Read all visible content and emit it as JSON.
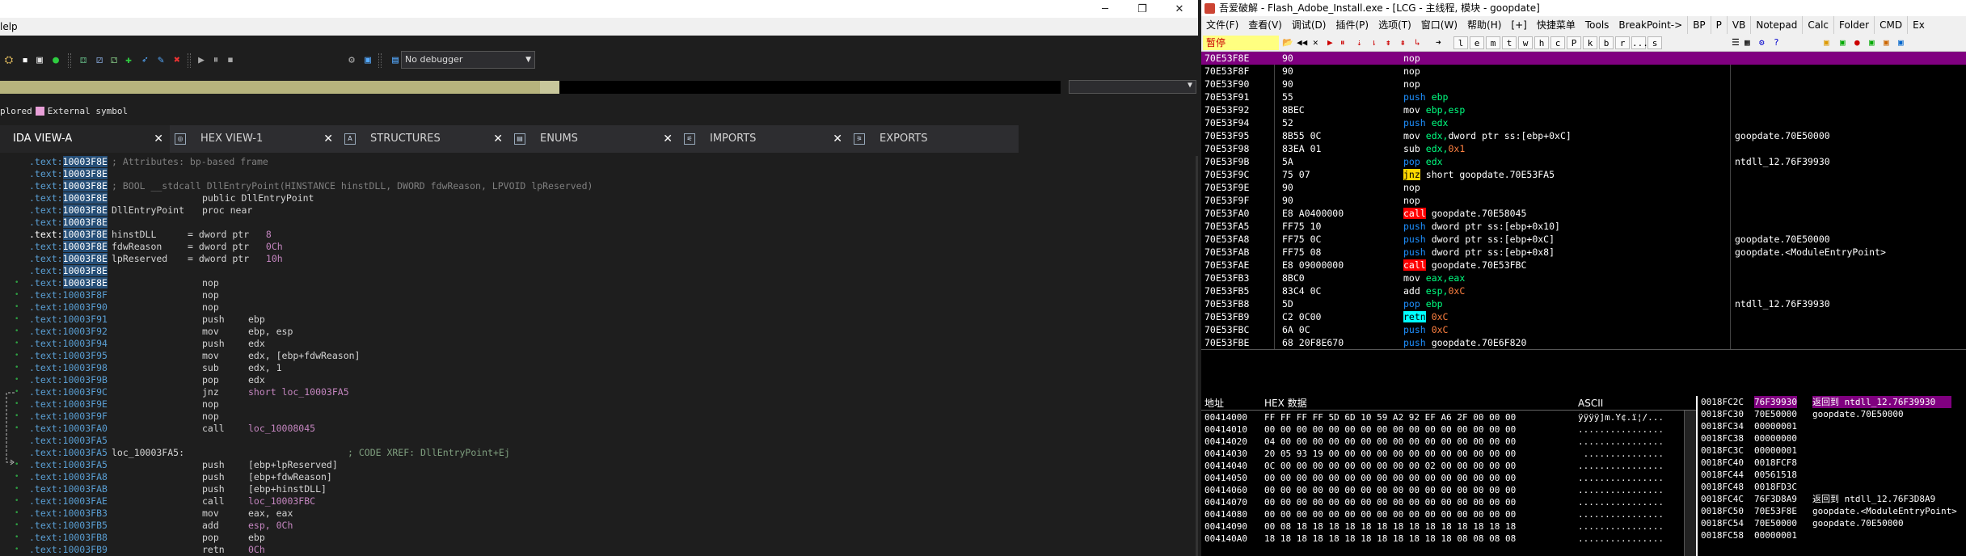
{
  "ida": {
    "menu_help": "lelp",
    "window_buttons": [
      "─",
      "❐",
      "✕"
    ],
    "debugger_select": "No debugger",
    "legend": [
      {
        "label": "plored",
        "color": ""
      },
      {
        "label": "External symbol",
        "color": "#e8a0d8"
      }
    ],
    "tabs": [
      {
        "label": "IDA VIEW-A",
        "icon": "",
        "close": "✕",
        "active": true
      },
      {
        "label": "HEX VIEW-1",
        "icon": "◎",
        "close": "✕",
        "active": false
      },
      {
        "label": "STRUCTURES",
        "icon": "A",
        "close": "✕",
        "active": false
      },
      {
        "label": "ENUMS",
        "icon": "▤",
        "close": "✕",
        "active": false
      },
      {
        "label": "IMPORTS",
        "icon": "⚟",
        "close": "✕",
        "active": false
      },
      {
        "label": "EXPORTS",
        "icon": "⚞",
        "close": "",
        "active": false
      }
    ],
    "code_lines": [
      {
        "dot": "",
        "addr": ".text:",
        "addr_hl": "10003F8E",
        "kind": "cmt",
        "text": "; Attributes: bp-based frame"
      },
      {
        "dot": "",
        "addr": ".text:",
        "addr_hl": "10003F8E",
        "kind": "blank",
        "text": ""
      },
      {
        "dot": "",
        "addr": ".text:",
        "addr_hl": "10003F8E",
        "kind": "cmt",
        "text": "; BOOL __stdcall DllEntryPoint(HINSTANCE hinstDLL, DWORD fdwReason, LPVOID lpReserved)"
      },
      {
        "dot": "",
        "addr": ".text:",
        "addr_hl": "10003F8E",
        "kind": "decl",
        "text": "public DllEntryPoint"
      },
      {
        "dot": "",
        "addr": ".text:",
        "addr_hl": "10003F8E",
        "kind": "proc",
        "label": "DllEntryPoint",
        "text": "proc near"
      },
      {
        "dot": "",
        "addr": ".text:",
        "addr_hl": "10003F8E",
        "kind": "blank",
        "text": ""
      },
      {
        "dot": "",
        "addr": ".text:",
        "addr_hl": "10003F8E",
        "kind": "var",
        "label": "hinstDLL",
        "text": "= dword ptr",
        "val": " 8",
        "cur": true
      },
      {
        "dot": "",
        "addr": ".text:",
        "addr_hl": "10003F8E",
        "kind": "var",
        "label": "fdwReason",
        "text": "= dword ptr",
        "val": " 0Ch"
      },
      {
        "dot": "",
        "addr": ".text:",
        "addr_hl": "10003F8E",
        "kind": "var",
        "label": "lpReserved",
        "text": "= dword ptr",
        "val": " 10h"
      },
      {
        "dot": "",
        "addr": ".text:",
        "addr_hl": "10003F8E",
        "kind": "blank",
        "text": ""
      },
      {
        "dot": "•",
        "addr": ".text:",
        "addr_hl": "10003F8E",
        "kind": "ins",
        "mn": "nop",
        "op": ""
      },
      {
        "dot": "•",
        "addr": ".text:10003F8F",
        "addr_hl": "",
        "kind": "ins",
        "mn": "nop",
        "op": ""
      },
      {
        "dot": "•",
        "addr": ".text:10003F90",
        "addr_hl": "",
        "kind": "ins",
        "mn": "nop",
        "op": ""
      },
      {
        "dot": "•",
        "addr": ".text:10003F91",
        "addr_hl": "",
        "kind": "ins",
        "mn": "push",
        "op": "ebp"
      },
      {
        "dot": "•",
        "addr": ".text:10003F92",
        "addr_hl": "",
        "kind": "ins",
        "mn": "mov",
        "op": "ebp, esp"
      },
      {
        "dot": "•",
        "addr": ".text:10003F94",
        "addr_hl": "",
        "kind": "ins",
        "mn": "push",
        "op": "edx"
      },
      {
        "dot": "•",
        "addr": ".text:10003F95",
        "addr_hl": "",
        "kind": "ins",
        "mn": "mov",
        "op": "edx, [ebp+fdwReason]"
      },
      {
        "dot": "•",
        "addr": ".text:10003F98",
        "addr_hl": "",
        "kind": "ins",
        "mn": "sub",
        "op": "edx, 1"
      },
      {
        "dot": "•",
        "addr": ".text:10003F9B",
        "addr_hl": "",
        "kind": "ins",
        "mn": "pop",
        "op": "edx"
      },
      {
        "dot": "•",
        "addr": ".text:10003F9C",
        "addr_hl": "",
        "kind": "ins",
        "mn": "jnz",
        "op": "short loc_10003FA5",
        "ref": true
      },
      {
        "dot": "•",
        "addr": ".text:10003F9E",
        "addr_hl": "",
        "kind": "ins",
        "mn": "nop",
        "op": ""
      },
      {
        "dot": "•",
        "addr": ".text:10003F9F",
        "addr_hl": "",
        "kind": "ins",
        "mn": "nop",
        "op": ""
      },
      {
        "dot": "•",
        "addr": ".text:10003FA0",
        "addr_hl": "",
        "kind": "ins",
        "mn": "call",
        "op": "loc_10008045",
        "ref": true
      },
      {
        "dot": "",
        "addr": ".text:10003FA5",
        "addr_hl": "",
        "kind": "blank",
        "text": ""
      },
      {
        "dot": "",
        "addr": ".text:10003FA5",
        "addr_hl": "",
        "kind": "loc",
        "label": "loc_10003FA5:",
        "xref": "; CODE XREF: DllEntryPoint+Ej"
      },
      {
        "dot": "•",
        "addr": ".text:10003FA5",
        "addr_hl": "",
        "kind": "ins",
        "mn": "push",
        "op": "[ebp+lpReserved]"
      },
      {
        "dot": "•",
        "addr": ".text:10003FA8",
        "addr_hl": "",
        "kind": "ins",
        "mn": "push",
        "op": "[ebp+fdwReason]"
      },
      {
        "dot": "•",
        "addr": ".text:10003FAB",
        "addr_hl": "",
        "kind": "ins",
        "mn": "push",
        "op": "[ebp+hinstDLL]"
      },
      {
        "dot": "•",
        "addr": ".text:10003FAE",
        "addr_hl": "",
        "kind": "ins",
        "mn": "call",
        "op": "loc_10003FBC",
        "ref": true
      },
      {
        "dot": "•",
        "addr": ".text:10003FB3",
        "addr_hl": "",
        "kind": "ins",
        "mn": "mov",
        "op": "eax, eax"
      },
      {
        "dot": "•",
        "addr": ".text:10003FB5",
        "addr_hl": "",
        "kind": "ins",
        "mn": "add",
        "op": "esp, 0Ch",
        "ref": true
      },
      {
        "dot": "•",
        "addr": ".text:10003FB8",
        "addr_hl": "",
        "kind": "ins",
        "mn": "pop",
        "op": "ebp"
      },
      {
        "dot": "•",
        "addr": ".text:10003FB9",
        "addr_hl": "",
        "kind": "ins",
        "mn": "retn",
        "op": "0Ch",
        "ref": true
      }
    ]
  },
  "xdbg": {
    "title": "吾爱破解 - Flash_Adobe_Install.exe - [LCG - 主线程, 模块 - goopdate]",
    "menu": [
      "文件(F)",
      "查看(V)",
      "调试(D)",
      "插件(P)",
      "选项(T)",
      "窗口(W)",
      "帮助(H)",
      "[+]",
      "快捷菜单",
      "Tools",
      "BreakPoint->",
      "BP",
      "P",
      "VB",
      "Notepad",
      "Calc",
      "Folder",
      "CMD",
      "Ex"
    ],
    "state": "暂停",
    "toolbar_letters": [
      "l",
      "e",
      "m",
      "t",
      "w",
      "h",
      "c",
      "P",
      "k",
      "b",
      "r",
      "...",
      "s"
    ],
    "cpu_rows": [
      {
        "addr": "70E53F8E",
        "bytes": "90",
        "mn": "nop",
        "mk": "plain",
        "ops": [],
        "cmt": "",
        "sel": true
      },
      {
        "addr": "70E53F8F",
        "bytes": "90",
        "mn": "nop",
        "mk": "plain",
        "ops": [],
        "cmt": ""
      },
      {
        "addr": "70E53F90",
        "bytes": "90",
        "mn": "nop",
        "mk": "plain",
        "ops": [],
        "cmt": ""
      },
      {
        "addr": "70E53F91",
        "bytes": "55",
        "mn": "push",
        "mk": "push",
        "ops": [
          {
            "t": "ebp",
            "c": "reg"
          }
        ],
        "cmt": ""
      },
      {
        "addr": "70E53F92",
        "bytes": "8BEC",
        "mn": "mov",
        "mk": "mov",
        "ops": [
          {
            "t": "ebp,esp",
            "c": "reg"
          }
        ],
        "cmt": ""
      },
      {
        "addr": "70E53F94",
        "bytes": "52",
        "mn": "push",
        "mk": "push",
        "ops": [
          {
            "t": "edx",
            "c": "reg"
          }
        ],
        "cmt": ""
      },
      {
        "addr": "70E53F95",
        "bytes": "8B55 0C",
        "mn": "mov",
        "mk": "mov",
        "ops": [
          {
            "t": "edx,",
            "c": "reg"
          },
          {
            "t": "dword ptr ss:[ebp+0xC]",
            "c": "addr"
          }
        ],
        "cmt": "goopdate.70E50000"
      },
      {
        "addr": "70E53F98",
        "bytes": "83EA 01",
        "mn": "sub",
        "mk": "mov",
        "ops": [
          {
            "t": "edx,",
            "c": "reg"
          },
          {
            "t": "0x1",
            "c": "num"
          }
        ],
        "cmt": ""
      },
      {
        "addr": "70E53F9B",
        "bytes": "5A",
        "mn": "pop",
        "mk": "pop",
        "ops": [
          {
            "t": "edx",
            "c": "reg"
          }
        ],
        "cmt": "ntdll_12.76F39930"
      },
      {
        "addr": "70E53F9C",
        "bytes": "75 07",
        "mn": "jnz",
        "mk": "jnz",
        "ops": [
          {
            "t": "short goopdate.70E53FA5",
            "c": "addr"
          }
        ],
        "cmt": ""
      },
      {
        "addr": "70E53F9E",
        "bytes": "90",
        "mn": "nop",
        "mk": "plain",
        "ops": [],
        "cmt": ""
      },
      {
        "addr": "70E53F9F",
        "bytes": "90",
        "mn": "nop",
        "mk": "plain",
        "ops": [],
        "cmt": ""
      },
      {
        "addr": "70E53FA0",
        "bytes": "E8 A0400000",
        "mn": "call",
        "mk": "call",
        "ops": [
          {
            "t": "goopdate.70E58045",
            "c": "addr"
          }
        ],
        "cmt": ""
      },
      {
        "addr": "70E53FA5",
        "bytes": "FF75 10",
        "mn": "push",
        "mk": "push",
        "ops": [
          {
            "t": "dword ptr ss:[ebp+0x10]",
            "c": "addr"
          }
        ],
        "cmt": ""
      },
      {
        "addr": "70E53FA8",
        "bytes": "FF75 0C",
        "mn": "push",
        "mk": "push",
        "ops": [
          {
            "t": "dword ptr ss:[ebp+0xC]",
            "c": "addr"
          }
        ],
        "cmt": "goopdate.70E50000"
      },
      {
        "addr": "70E53FAB",
        "bytes": "FF75 08",
        "mn": "push",
        "mk": "push",
        "ops": [
          {
            "t": "dword ptr ss:[ebp+0x8]",
            "c": "addr"
          }
        ],
        "cmt": "goopdate.<ModuleEntryPoint>"
      },
      {
        "addr": "70E53FAE",
        "bytes": "E8 09000000",
        "mn": "call",
        "mk": "call",
        "ops": [
          {
            "t": "goopdate.70E53FBC",
            "c": "addr"
          }
        ],
        "cmt": ""
      },
      {
        "addr": "70E53FB3",
        "bytes": "8BC0",
        "mn": "mov",
        "mk": "mov",
        "ops": [
          {
            "t": "eax,eax",
            "c": "reg"
          }
        ],
        "cmt": ""
      },
      {
        "addr": "70E53FB5",
        "bytes": "83C4 0C",
        "mn": "add",
        "mk": "add",
        "ops": [
          {
            "t": "esp,",
            "c": "reg"
          },
          {
            "t": "0xC",
            "c": "num"
          }
        ],
        "cmt": ""
      },
      {
        "addr": "70E53FB8",
        "bytes": "5D",
        "mn": "pop",
        "mk": "pop",
        "ops": [
          {
            "t": "ebp",
            "c": "reg"
          }
        ],
        "cmt": "ntdll_12.76F39930"
      },
      {
        "addr": "70E53FB9",
        "bytes": "C2 0C00",
        "mn": "retn",
        "mk": "retn",
        "ops": [
          {
            "t": "0xC",
            "c": "num"
          }
        ],
        "cmt": ""
      },
      {
        "addr": "70E53FBC",
        "bytes": "6A 0C",
        "mn": "push",
        "mk": "push",
        "ops": [
          {
            "t": "0xC",
            "c": "num"
          }
        ],
        "cmt": ""
      },
      {
        "addr": "70E53FBE",
        "bytes": "68 20F8E670",
        "mn": "push",
        "mk": "push",
        "ops": [
          {
            "t": "goopdate.70E6F820",
            "c": "addr"
          }
        ],
        "cmt": ""
      }
    ],
    "dump_headers": {
      "addr": "地址",
      "hex": "HEX 数据",
      "ascii": "ASCII"
    },
    "dump_rows": [
      {
        "a": "00414000",
        "h": "FF FF FF FF 5D 6D 10 59 A2 92 EF A6 2F 00 00 00",
        "s": "ÿÿÿÿ]m.Y¢.ï¦/..."
      },
      {
        "a": "00414010",
        "h": "00 00 00 00 00 00 00 00 00 00 00 00 00 00 00 00",
        "s": "................"
      },
      {
        "a": "00414020",
        "h": "04 00 00 00 00 00 00 00 00 00 00 00 00 00 00 00",
        "s": "................"
      },
      {
        "a": "00414030",
        "h": "20 05 93 19 00 00 00 00 00 00 00 00 00 00 00 00",
        "s": " ..............."
      },
      {
        "a": "00414040",
        "h": "0C 00 00 00 00 00 00 00 00 00 02 00 00 00 00 00",
        "s": "................"
      },
      {
        "a": "00414050",
        "h": "00 00 00 00 00 00 00 00 00 00 00 00 00 00 00 00",
        "s": "................"
      },
      {
        "a": "00414060",
        "h": "00 00 00 00 00 00 00 00 00 00 00 00 00 00 00 00",
        "s": "................"
      },
      {
        "a": "00414070",
        "h": "00 00 00 00 00 00 00 00 00 00 00 00 00 00 00 00",
        "s": "................"
      },
      {
        "a": "00414080",
        "h": "00 00 00 00 00 00 00 00 00 00 00 00 00 00 00 00",
        "s": "................"
      },
      {
        "a": "00414090",
        "h": "00 08 18 18 18 18 18 18 18 18 18 18 18 18 18 18",
        "s": "................"
      },
      {
        "a": "004140A0",
        "h": "18 18 18 18 18 18 18 18 18 18 18 18 08 08 08 08",
        "s": "................"
      }
    ],
    "stack_rows": [
      {
        "a": "0018FC2C",
        "v": "76F39930",
        "c": "返回到 ntdll_12.76F39930",
        "sel": true
      },
      {
        "a": "0018FC30",
        "v": "70E50000",
        "c": "goopdate.70E50000"
      },
      {
        "a": "0018FC34",
        "v": "00000001",
        "c": ""
      },
      {
        "a": "0018FC38",
        "v": "00000000",
        "c": ""
      },
      {
        "a": "0018FC3C",
        "v": "00000001",
        "c": ""
      },
      {
        "a": "0018FC40",
        "v": "0018FCF8",
        "c": ""
      },
      {
        "a": "0018FC44",
        "v": "00561518",
        "c": ""
      },
      {
        "a": "0018FC48",
        "v": "0018FD3C",
        "c": ""
      },
      {
        "a": "0018FC4C",
        "v": "76F3D8A9",
        "c": "返回到 ntdll_12.76F3D8A9"
      },
      {
        "a": "0018FC50",
        "v": "70E53F8E",
        "c": "goopdate.<ModuleEntryPoint>"
      },
      {
        "a": "0018FC54",
        "v": "70E50000",
        "c": "goopdate.70E50000"
      },
      {
        "a": "0018FC58",
        "v": "00000001",
        "c": ""
      }
    ]
  }
}
